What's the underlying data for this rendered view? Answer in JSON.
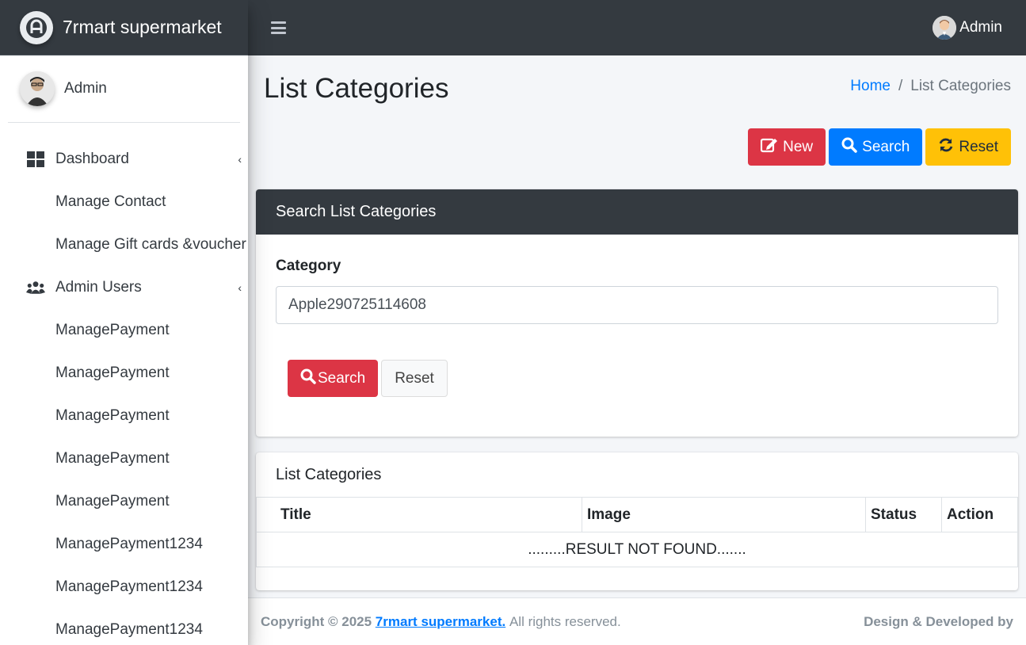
{
  "brand": {
    "name": "7rmart supermarket"
  },
  "sidebar": {
    "user": "Admin",
    "items": [
      {
        "label": "Dashboard",
        "icon": "dashboard-icon",
        "caret": "‹"
      },
      {
        "label": "Manage Contact"
      },
      {
        "label": "Manage Gift cards &voucher"
      },
      {
        "label": "Admin Users",
        "icon": "users-icon",
        "caret": "‹"
      },
      {
        "label": "ManagePayment"
      },
      {
        "label": "ManagePayment"
      },
      {
        "label": "ManagePayment"
      },
      {
        "label": "ManagePayment"
      },
      {
        "label": "ManagePayment"
      },
      {
        "label": "ManagePayment1234"
      },
      {
        "label": "ManagePayment1234"
      },
      {
        "label": "ManagePayment1234"
      }
    ]
  },
  "topbar": {
    "user": "Admin"
  },
  "page": {
    "title": "List Categories",
    "breadcrumb": {
      "home": "Home",
      "separator": "/",
      "current": "List Categories"
    }
  },
  "actions": {
    "new": "New",
    "search": "Search",
    "reset": "Reset"
  },
  "search_card": {
    "header": "Search List Categories",
    "label": "Category",
    "value": "Apple290725114608",
    "search_button": "Search",
    "reset_button": "Reset"
  },
  "list_card": {
    "title": "List Categories",
    "columns": [
      "Title",
      "Image",
      "Status",
      "Action"
    ],
    "empty_message": ".........RESULT NOT FOUND......."
  },
  "footer": {
    "copyright_prefix": "Copyright © 2025",
    "brand_link": "7rmart supermarket.",
    "suffix": "All rights reserved.",
    "right": "Design & Developed by"
  },
  "colors": {
    "dark": "#343a40",
    "primary": "#007bff",
    "danger": "#dc3545",
    "warning": "#ffc107"
  }
}
